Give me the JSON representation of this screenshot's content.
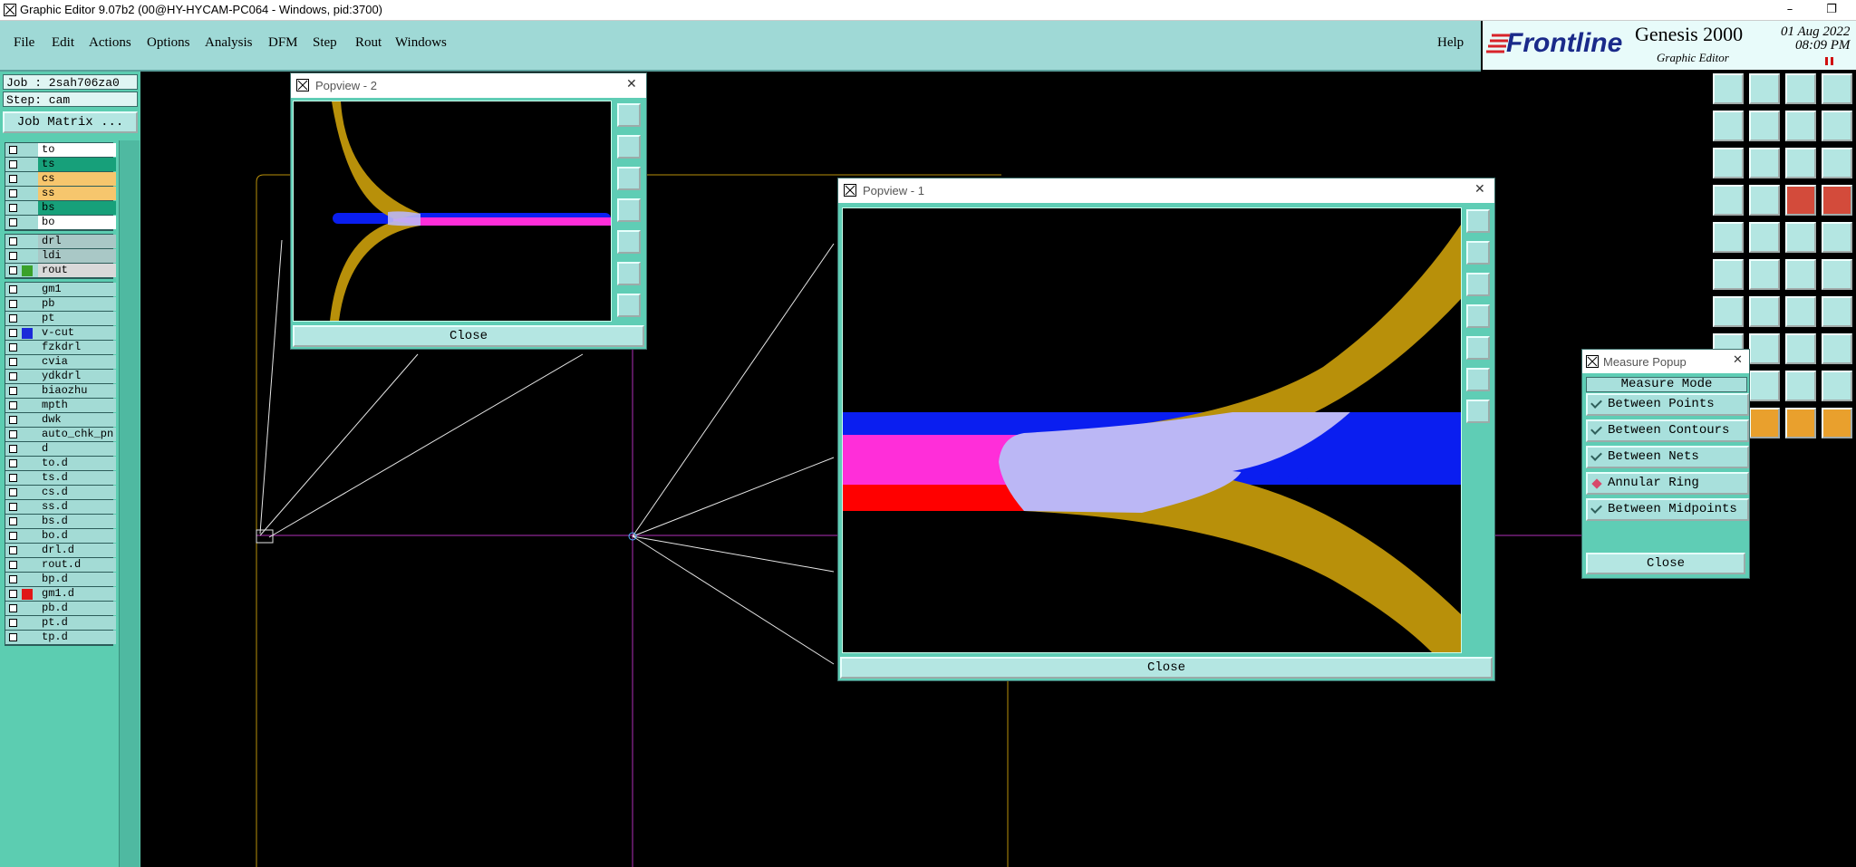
{
  "window": {
    "title": "Graphic Editor 9.07b2 (00@HY-HYCAM-PC064 - Windows, pid:3700)",
    "minimize": "–",
    "restore": "❐",
    "close": "✕"
  },
  "menu": {
    "items": [
      "File",
      "Edit",
      "Actions",
      "Options",
      "Analysis",
      "DFM",
      "Step",
      "Rout",
      "Windows"
    ],
    "help": "Help"
  },
  "brand": {
    "logo": "Frontline",
    "product": "Genesis 2000",
    "subtitle": "Graphic Editor",
    "date": "01 Aug 2022",
    "time": "08:09 PM"
  },
  "job": {
    "job_line": "Job : 2sah706za0",
    "step_line": "Step: cam",
    "matrix_button": "Job Matrix ..."
  },
  "layers": {
    "group1": [
      {
        "name": "to",
        "bg": "#ffffff",
        "swatch": "",
        "mark": "⬋"
      },
      {
        "name": "ts",
        "bg": "#17a07a",
        "swatch": "",
        "mark": ""
      },
      {
        "name": "cs",
        "bg": "#f6c66d",
        "swatch": "",
        "mark": ""
      },
      {
        "name": "ss",
        "bg": "#f6c66d",
        "swatch": "",
        "mark": ""
      },
      {
        "name": "bs",
        "bg": "#17a07a",
        "swatch": "",
        "mark": ""
      },
      {
        "name": "bo",
        "bg": "#ffffff",
        "swatch": "",
        "mark": "⬋"
      }
    ],
    "group2": [
      {
        "name": "drl",
        "bg": "#a9c8c6",
        "swatch": "",
        "mark": ""
      },
      {
        "name": "ldi",
        "bg": "#a9c8c6",
        "swatch": "",
        "mark": ""
      },
      {
        "name": "rout",
        "bg": "#d9d9d9",
        "swatch": "#3aa12a",
        "mark": "■"
      }
    ],
    "group3": [
      {
        "name": "gm1",
        "bg": "#a3dbd5",
        "swatch": "",
        "mark": ""
      },
      {
        "name": "pb",
        "bg": "#a3dbd5",
        "swatch": "",
        "mark": ""
      },
      {
        "name": "pt",
        "bg": "#a3dbd5",
        "swatch": "",
        "mark": ""
      },
      {
        "name": "v-cut",
        "bg": "#a3dbd5",
        "swatch": "#1b2ad9",
        "mark": ""
      },
      {
        "name": "fzkdrl",
        "bg": "#a3dbd5",
        "swatch": "",
        "mark": ""
      },
      {
        "name": "cvia",
        "bg": "#a3dbd5",
        "swatch": "",
        "mark": ""
      },
      {
        "name": "ydkdrl",
        "bg": "#a3dbd5",
        "swatch": "",
        "mark": ""
      },
      {
        "name": "biaozhu",
        "bg": "#a3dbd5",
        "swatch": "",
        "mark": ""
      },
      {
        "name": "mpth",
        "bg": "#a3dbd5",
        "swatch": "",
        "mark": ""
      },
      {
        "name": "dwk",
        "bg": "#a3dbd5",
        "swatch": "",
        "mark": ""
      },
      {
        "name": "auto_chk_pn",
        "bg": "#a3dbd5",
        "swatch": "",
        "mark": ""
      },
      {
        "name": "d",
        "bg": "#a3dbd5",
        "swatch": "",
        "mark": ""
      },
      {
        "name": "to.d",
        "bg": "#a3dbd5",
        "swatch": "",
        "mark": "⬋"
      },
      {
        "name": "ts.d",
        "bg": "#a3dbd5",
        "swatch": "",
        "mark": ""
      },
      {
        "name": "cs.d",
        "bg": "#a3dbd5",
        "swatch": "",
        "mark": ""
      },
      {
        "name": "ss.d",
        "bg": "#a3dbd5",
        "swatch": "",
        "mark": ""
      },
      {
        "name": "bs.d",
        "bg": "#a3dbd5",
        "swatch": "",
        "mark": ""
      },
      {
        "name": "bo.d",
        "bg": "#a3dbd5",
        "swatch": "",
        "mark": "⬋"
      },
      {
        "name": "drl.d",
        "bg": "#a3dbd5",
        "swatch": "",
        "mark": ""
      },
      {
        "name": "rout.d",
        "bg": "#a3dbd5",
        "swatch": "",
        "mark": ""
      },
      {
        "name": "bp.d",
        "bg": "#a3dbd5",
        "swatch": "",
        "mark": ""
      },
      {
        "name": "gm1.d",
        "bg": "#a3dbd5",
        "swatch": "#e01717",
        "mark": ""
      },
      {
        "name": "pb.d",
        "bg": "#a3dbd5",
        "swatch": "",
        "mark": ""
      },
      {
        "name": "pt.d",
        "bg": "#a3dbd5",
        "swatch": "",
        "mark": ""
      },
      {
        "name": "tp.d",
        "bg": "#a3dbd5",
        "swatch": "",
        "mark": ""
      }
    ]
  },
  "popview2": {
    "title": "Popview - 2",
    "close_label": "Close",
    "close_x": "✕"
  },
  "popview1": {
    "title": "Popview - 1",
    "close_label": "Close",
    "close_x": "✕"
  },
  "measure": {
    "title": "Measure Popup",
    "header": "Measure Mode",
    "options": [
      {
        "label": "Between Points",
        "state": "check"
      },
      {
        "label": "Between Contours",
        "state": "check"
      },
      {
        "label": "Between Nets",
        "state": "check"
      },
      {
        "label": "Annular Ring",
        "state": "selected"
      },
      {
        "label": "Between Midpoints",
        "state": "check"
      }
    ],
    "close_label": "Close",
    "close_x": "✕"
  },
  "icons": {
    "app_icon": "graphic-editor-icon"
  },
  "colors": {
    "panel": "#5ccdb1",
    "menu_bg": "#9fd9d6",
    "copper": "#b8900a",
    "blue": "#0a1ef0",
    "magenta": "#ff2ed9",
    "red": "#ff0000",
    "lavender": "#bbb7f5"
  }
}
